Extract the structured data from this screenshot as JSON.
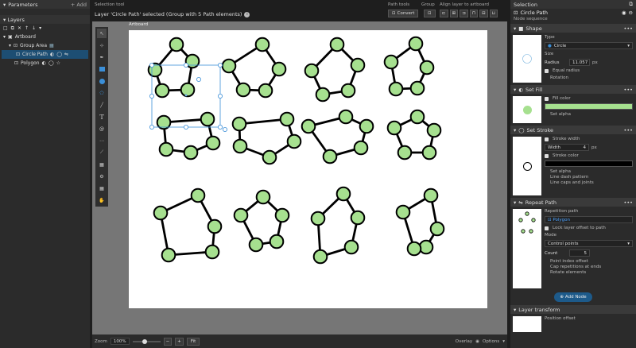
{
  "left": {
    "parameters_title": "Parameters",
    "add_label": "+ Add",
    "layers_title": "Layers",
    "tree": [
      {
        "label": "Artboard",
        "depth": 0
      },
      {
        "label": "Group Area",
        "depth": 1
      },
      {
        "label": "Circle Path",
        "depth": 2,
        "selected": true
      },
      {
        "label": "Polygon",
        "depth": 2
      }
    ]
  },
  "top": {
    "tool_label": "Selection tool",
    "status": "Layer 'Circle Path' selected (Group with 5 Path elements)",
    "path_tools_label": "Path tools",
    "convert_label": "Convert",
    "group_label": "Group",
    "align_label": "Align layer to artboard"
  },
  "canvas": {
    "artboard_label": "Artboard",
    "node_fill": "#a6e08f",
    "bg": "#767676"
  },
  "bottom": {
    "zoom_label": "Zoom",
    "zoom_value": "100%",
    "zoom_slider": 0.45,
    "fit_label": "Fit",
    "overlay_label": "Overlay",
    "options_label": "Options"
  },
  "right": {
    "selection_title": "Selection",
    "layer_name": "Circle Path",
    "node_sequence": "Node sequence",
    "shape": {
      "title": "Shape",
      "type_label": "Type",
      "type_value": "Circle",
      "size_label": "Size",
      "radius_label": "Radius",
      "radius_value": "11.057",
      "unit": "px",
      "equal_radius": "Equal radius",
      "rotation": "Rotation"
    },
    "fill": {
      "title": "Set Fill",
      "fill_color_label": "Fill color",
      "fill_color": "#a6e08f",
      "set_alpha": "Set alpha"
    },
    "stroke": {
      "title": "Set Stroke",
      "stroke_width_label": "Stroke width",
      "width_label": "Width",
      "width_value": "4",
      "unit": "px",
      "stroke_color_label": "Stroke color",
      "stroke_color": "#000000",
      "set_alpha": "Set alpha",
      "dash": "Line dash pattern",
      "caps": "Line caps and joints"
    },
    "repeat": {
      "title": "Repeat Path",
      "repetition_path_label": "Repetition path",
      "repetition_path_value": "Polygon",
      "lock_offset": "Lock layer offset to path",
      "mode_label": "Mode",
      "mode_value": "Control points",
      "count_label": "Count",
      "count_value": "5",
      "point_index_offset": "Point index offset",
      "cap_repetitions": "Cap repetitions at ends",
      "rotate_elements": "Rotate elements"
    },
    "add_node_label": "Add Node",
    "layer_transform": {
      "title": "Layer transform",
      "position_offset": "Position offset"
    }
  }
}
